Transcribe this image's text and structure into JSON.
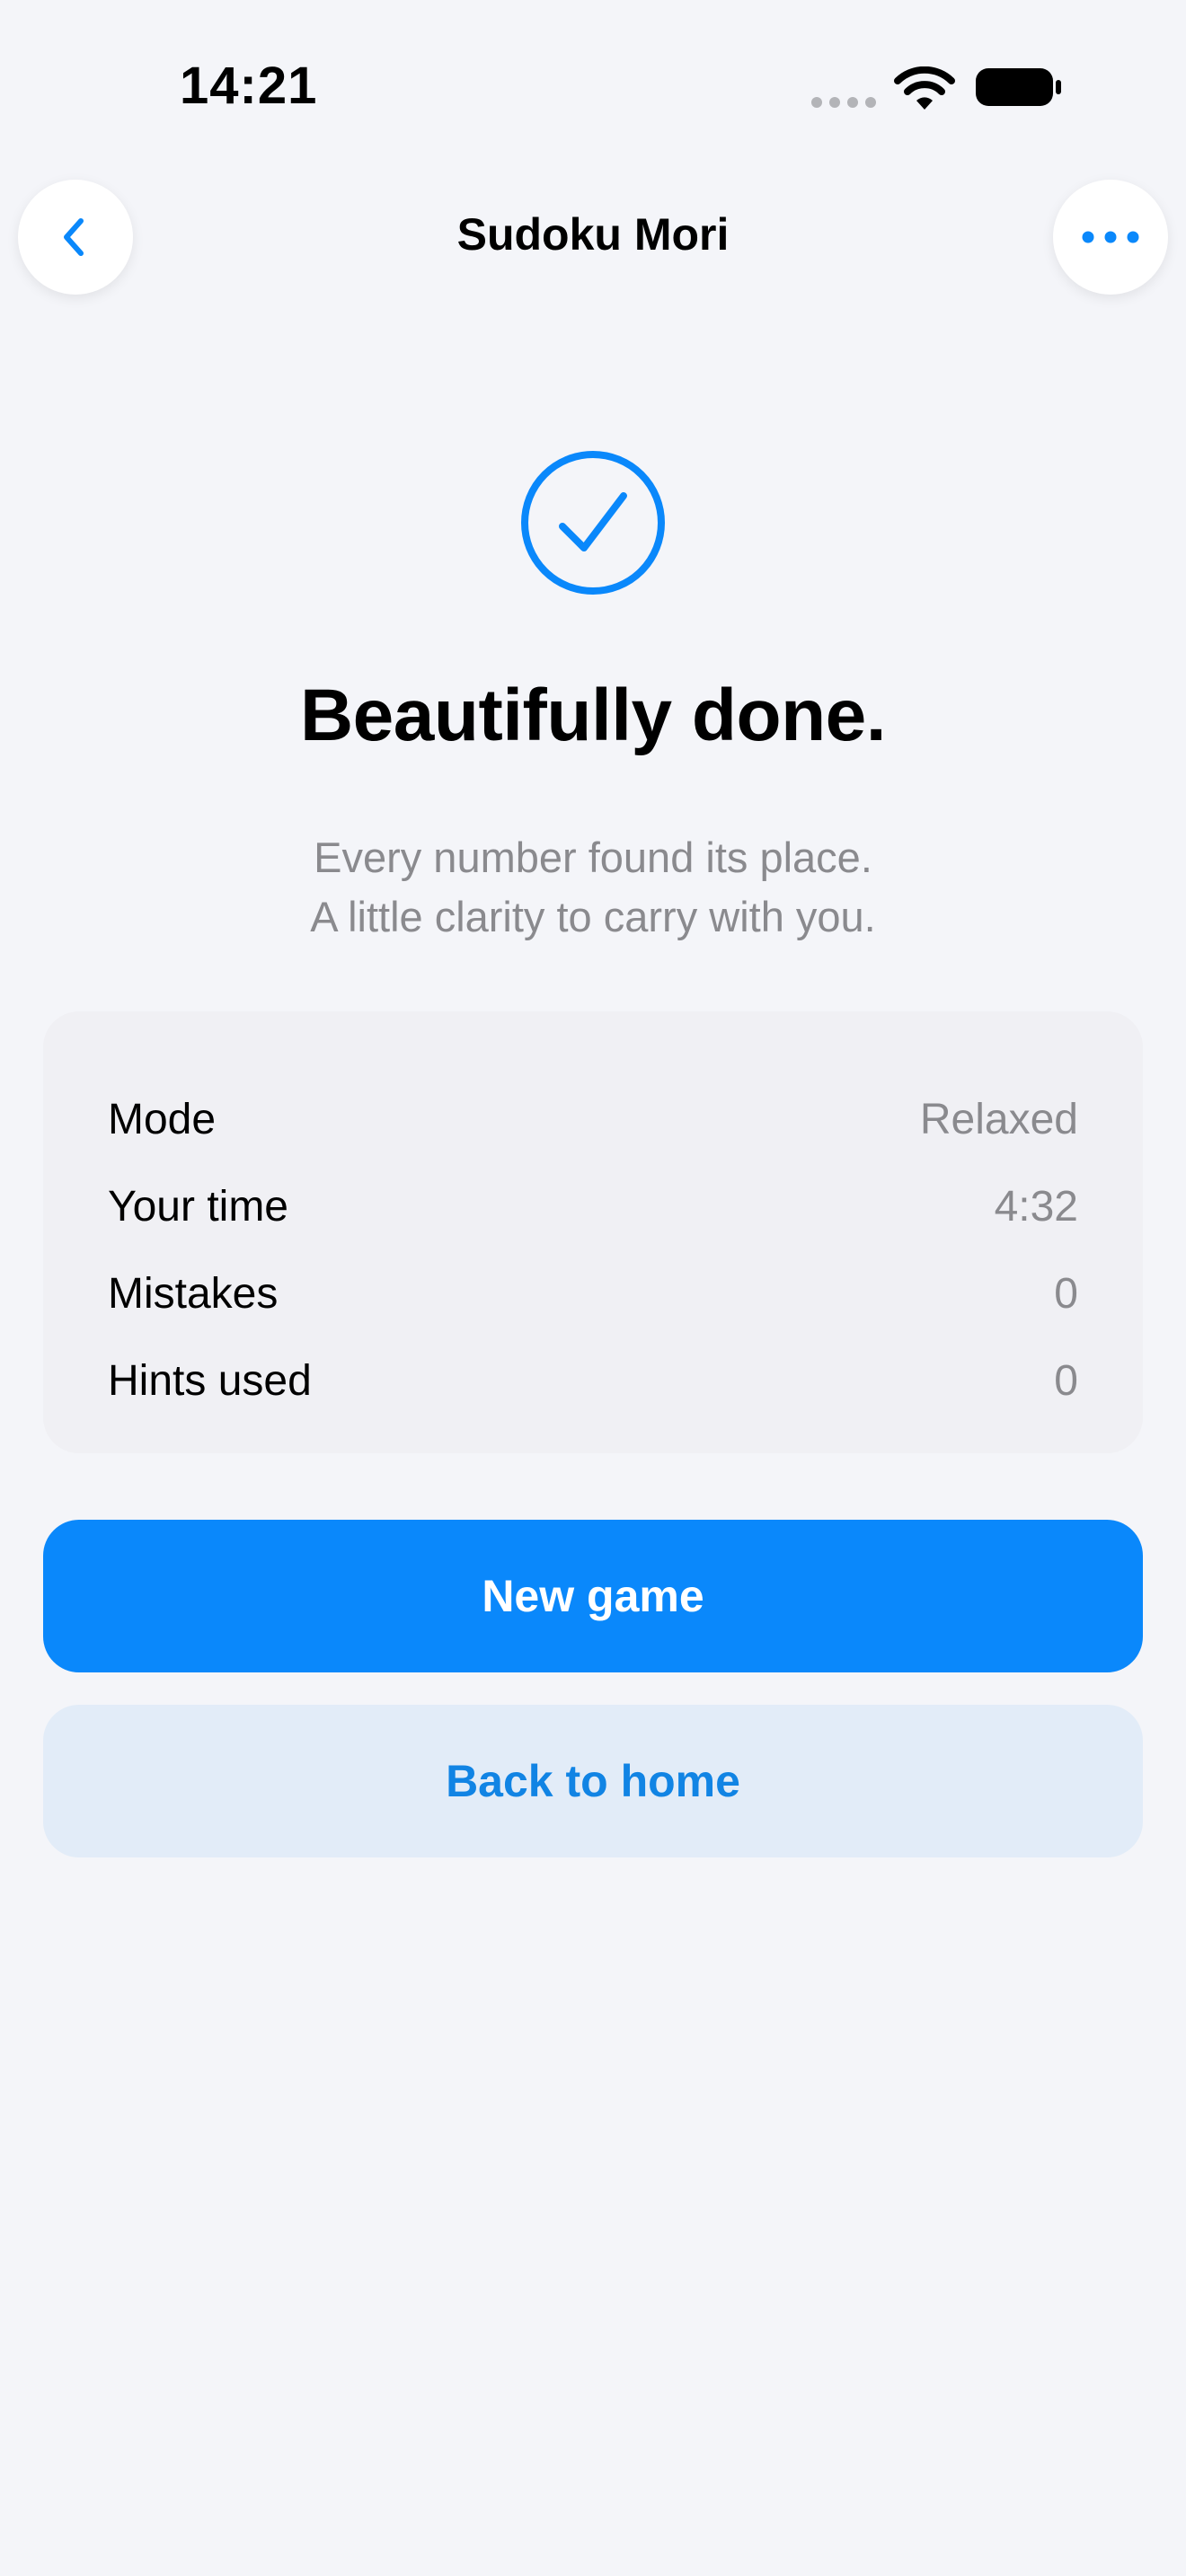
{
  "status_bar": {
    "time": "14:21"
  },
  "nav": {
    "title": "Sudoku Mori",
    "back_icon": "chevron-left-icon",
    "more_icon": "ellipsis-icon"
  },
  "completion": {
    "icon": "checkmark-circle-icon",
    "headline": "Beautifully done.",
    "subtitle_line1": "Every number found its place.",
    "subtitle_line2": "A little clarity to carry with you."
  },
  "stats": [
    {
      "label": "Mode",
      "value": "Relaxed"
    },
    {
      "label": "Your time",
      "value": "4:32"
    },
    {
      "label": "Mistakes",
      "value": "0"
    },
    {
      "label": "Hints used",
      "value": "0"
    }
  ],
  "actions": {
    "new_game_label": "New game",
    "back_home_label": "Back to home"
  },
  "colors": {
    "accent": "#0A88FB",
    "background": "#F4F5F9",
    "card": "#F0F0F4",
    "secondary_button": "#E2ECF8",
    "secondary_text": "#8A8A8E"
  }
}
